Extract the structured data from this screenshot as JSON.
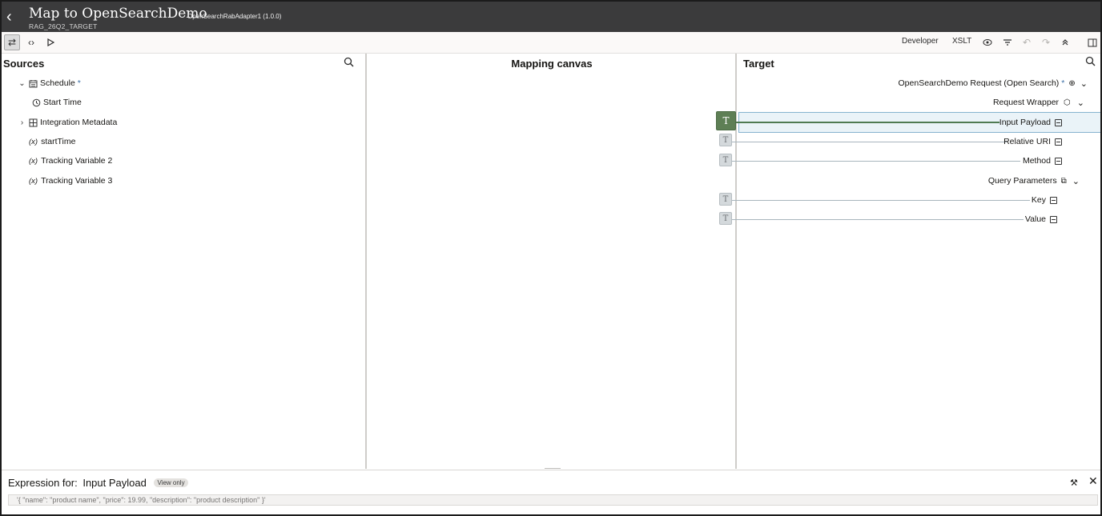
{
  "header": {
    "title": "Map to OpenSearchDemo",
    "subtitle": "RAG_26Q2_TARGET",
    "adapter": "OpenSearchRabAdapter1 (1.0.0)"
  },
  "toolbar": {
    "developer_label": "Developer",
    "xslt_label": "XSLT"
  },
  "sources": {
    "title": "Sources",
    "items": [
      {
        "label": "Schedule",
        "required_marker": "*"
      },
      {
        "label": "Start Time"
      },
      {
        "label": "Integration Metadata"
      },
      {
        "label": "startTime",
        "prefix": "(x)"
      },
      {
        "label": "Tracking Variable 2",
        "prefix": "(x)"
      },
      {
        "label": "Tracking Variable 3",
        "prefix": "(x)"
      }
    ]
  },
  "canvas": {
    "title": "Mapping canvas",
    "badge_glyph": "T"
  },
  "target": {
    "title": "Target",
    "items": [
      {
        "label": "OpenSearchDemo Request (Open Search)",
        "required_marker": "*"
      },
      {
        "label": "Request Wrapper"
      },
      {
        "label": "Input Payload",
        "mapped": true
      },
      {
        "label": "Relative URI"
      },
      {
        "label": "Method"
      },
      {
        "label": "Query Parameters"
      },
      {
        "label": "Key"
      },
      {
        "label": "Value"
      }
    ]
  },
  "expression": {
    "prefix": "Expression for:",
    "target": "Input Payload",
    "badge": "View only",
    "value": "'{  \"name\": \"product name\", \"price\": 19.99, \"description\": \"product description\" }'"
  },
  "colors": {
    "header_bg": "#3b3b3c",
    "mapped_badge": "#5e7f55",
    "selection_bg": "#eaf3f8"
  }
}
